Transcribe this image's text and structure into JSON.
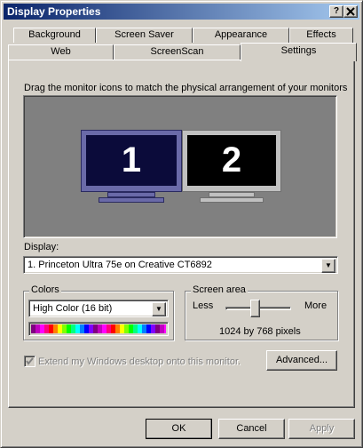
{
  "window": {
    "title": "Display Properties",
    "help_label": "?",
    "close_label": "x"
  },
  "tabs": {
    "row1": [
      "Background",
      "Screen Saver",
      "Appearance",
      "Effects"
    ],
    "row2": [
      "Web",
      "ScreenScan"
    ],
    "active": "Settings"
  },
  "settings": {
    "instruction": "Drag the monitor icons to match the physical arrangement of your monitors",
    "monitor1_number": "1",
    "monitor2_number": "2",
    "display_label": "Display:",
    "display_value": "1. Princeton Ultra 75e on Creative CT6892",
    "colors": {
      "group_label": "Colors",
      "value": "High Color (16 bit)"
    },
    "screen_area": {
      "group_label": "Screen area",
      "less_label": "Less",
      "more_label": "More",
      "resolution_text": "1024 by 768 pixels",
      "slider_level": 0.45
    },
    "extend_label": "Extend my Windows desktop onto this monitor.",
    "extend_checked": true,
    "extend_enabled": false,
    "advanced_label": "Advanced..."
  },
  "buttons": {
    "ok": "OK",
    "cancel": "Cancel",
    "apply": "Apply"
  },
  "colors": {
    "titlebar_start": "#0a246a",
    "monitor1_frame": "#6a6aa8",
    "monitor2_frame": "#c0c0c0",
    "desktop_bg": "#808080"
  }
}
